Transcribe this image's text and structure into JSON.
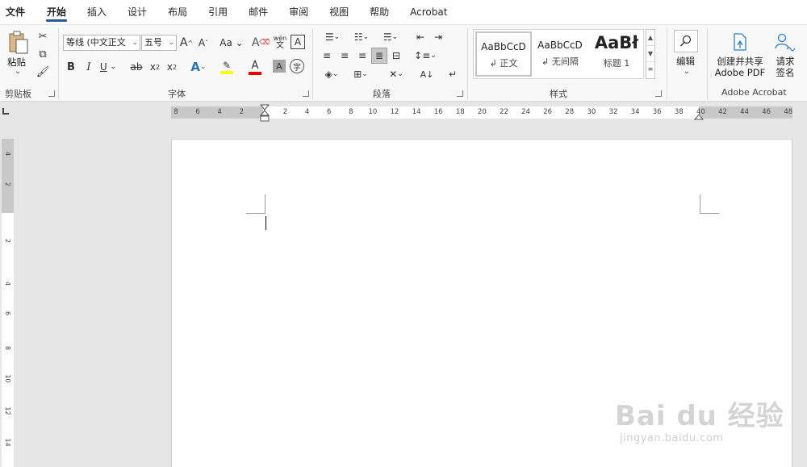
{
  "tabs": [
    "文件",
    "开始",
    "插入",
    "设计",
    "布局",
    "引用",
    "邮件",
    "审阅",
    "视图",
    "帮助",
    "Acrobat"
  ],
  "active_tab": "开始",
  "clipboard": {
    "paste_label": "粘贴",
    "group_label": "剪贴板"
  },
  "font": {
    "name_value": "等线 (中文正文",
    "size_value": "五号",
    "group_label": "字体",
    "wen_label": "wén"
  },
  "paragraph": {
    "group_label": "段落"
  },
  "styles": {
    "group_label": "样式",
    "items": [
      {
        "sample": "AaBbCcD",
        "name": "正文"
      },
      {
        "sample": "AaBbCcD",
        "name": "无间隔"
      },
      {
        "sample": "AaBł",
        "name": "标题 1"
      }
    ]
  },
  "editing": {
    "label": "编辑"
  },
  "acrobat": {
    "create_label_1": "创建并共享",
    "create_label_2": "Adobe PDF",
    "sign_label_1": "请求",
    "sign_label_2": "签名",
    "group_label": "Adobe Acrobat"
  },
  "ruler": {
    "h_labels": [
      "8",
      "6",
      "4",
      "2",
      "2",
      "4",
      "6",
      "8",
      "10",
      "12",
      "14",
      "16",
      "18",
      "20",
      "22",
      "24",
      "26",
      "28",
      "30",
      "32",
      "34",
      "36",
      "38",
      "40",
      "42",
      "44",
      "46",
      "48"
    ],
    "v_labels": [
      "4",
      "2",
      "2",
      "4",
      "6",
      "8",
      "10",
      "12",
      "14"
    ]
  },
  "watermark": {
    "main": "Bai du 经验",
    "sub": "jingyan.baidu.com"
  }
}
